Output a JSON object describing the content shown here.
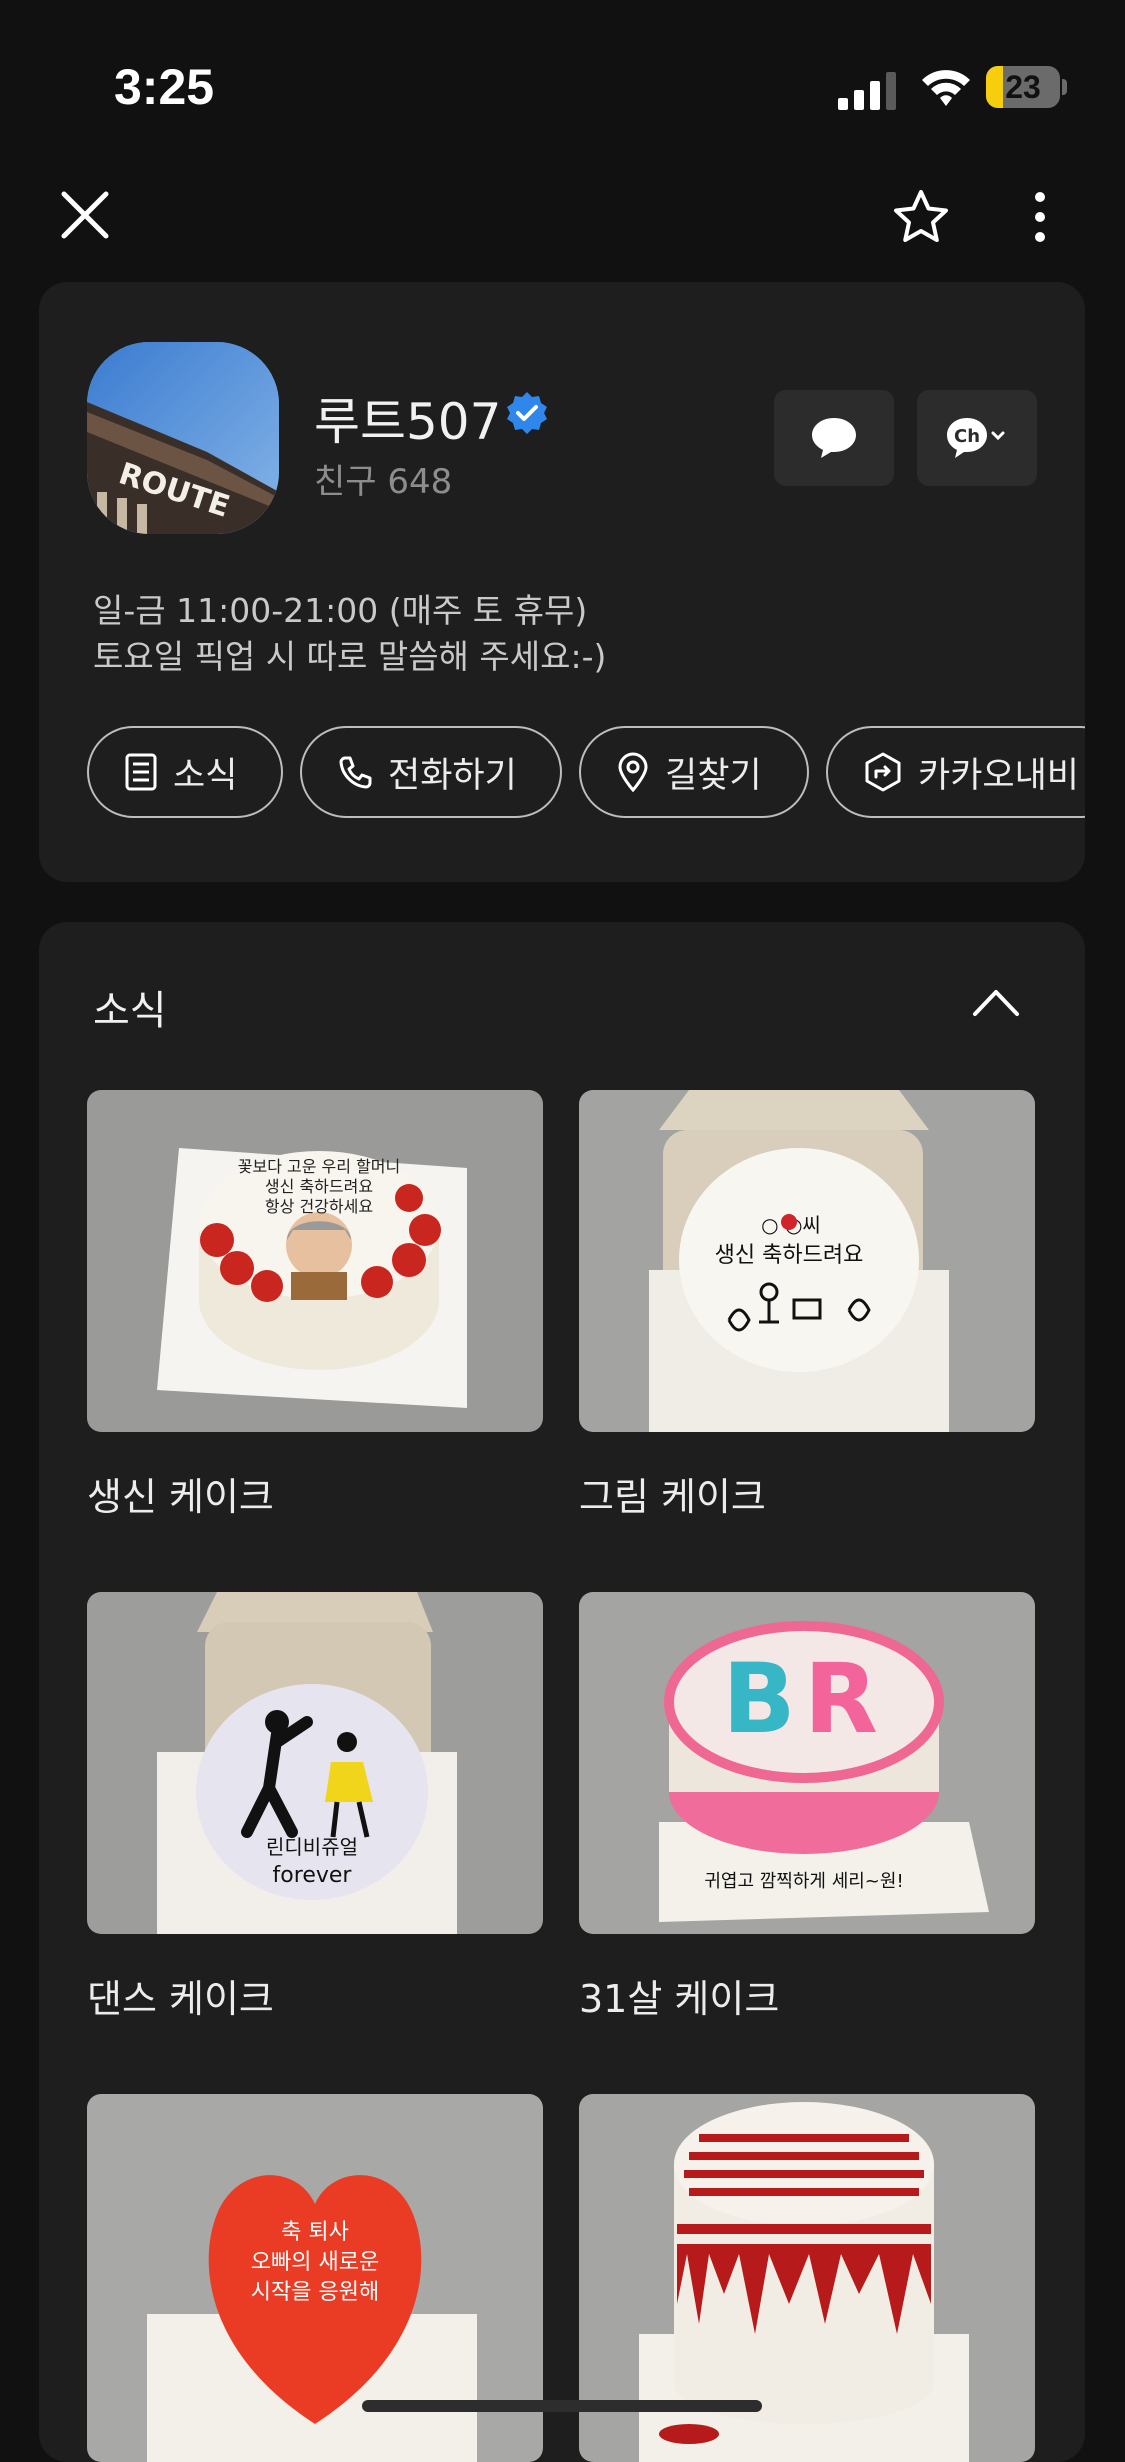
{
  "status_bar": {
    "time": "3:25",
    "battery_level": 23,
    "battery_text": "23"
  },
  "colors": {
    "accent_verified": "#2F86EB",
    "battery": "#F7CE0E",
    "card_bg": "#1E1E1E",
    "page_bg": "#111111"
  },
  "nav": {
    "close_icon": "close-icon",
    "favorite_icon": "star-icon",
    "more_icon": "more-vertical-icon"
  },
  "profile": {
    "name": "루트507",
    "friends": "친구 648",
    "hours_line1": "일-금 11:00-21:00 (매주 토 휴무)",
    "hours_line2": "토요일 픽업 시 따로 말씀해 주세요:-)",
    "actions": [
      {
        "label": "소식",
        "icon": "news-icon"
      },
      {
        "label": "전화하기",
        "icon": "phone-icon"
      },
      {
        "label": "길찾기",
        "icon": "location-pin-icon"
      },
      {
        "label": "카카오내비",
        "icon": "navi-icon"
      }
    ]
  },
  "news": {
    "title": "소식",
    "items": [
      {
        "caption": "생신 케이크",
        "image": "portrait-cake-photo"
      },
      {
        "caption": "그림 케이크",
        "image": "drawing-cake-photo"
      },
      {
        "caption": "댄스 케이크",
        "image": "dance-cake-photo"
      },
      {
        "caption": "31살 케이크",
        "image": "br-cake-photo"
      },
      {
        "caption": "",
        "image": "heart-cake-photo"
      },
      {
        "caption": "",
        "image": "red-text-cake-photo"
      }
    ]
  }
}
